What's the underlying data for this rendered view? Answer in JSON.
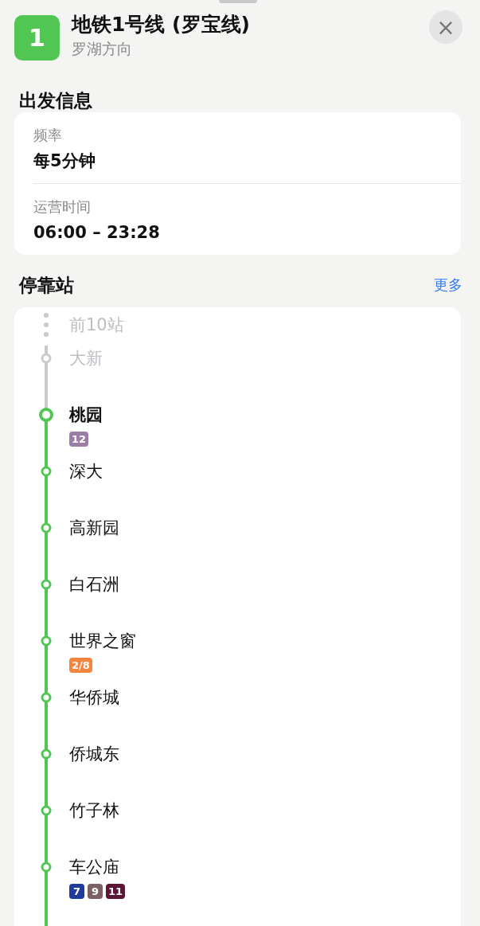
{
  "header": {
    "line_number": "1",
    "title": "地铁1号线 (罗宝线)",
    "subtitle": "罗湖方向",
    "close": "×"
  },
  "departure": {
    "title": "出发信息",
    "rows": [
      {
        "label": "频率",
        "value": "每5分钟"
      },
      {
        "label": "运营时间",
        "value": "06:00 – 23:28"
      }
    ]
  },
  "stops": {
    "title": "停靠站",
    "more": "更多",
    "stations": [
      {
        "kind": "collapsed",
        "name": "前10站"
      },
      {
        "kind": "passed",
        "name": "大新"
      },
      {
        "kind": "current",
        "name": "桃园",
        "transfers": [
          {
            "label": "12",
            "color": "#9a7ea5"
          }
        ]
      },
      {
        "kind": "stop",
        "name": "深大"
      },
      {
        "kind": "stop",
        "name": "高新园"
      },
      {
        "kind": "stop",
        "name": "白石洲"
      },
      {
        "kind": "stop",
        "name": "世界之窗",
        "transfers": [
          {
            "label": "2/8",
            "color": "#f7843e"
          }
        ]
      },
      {
        "kind": "stop",
        "name": "华侨城"
      },
      {
        "kind": "stop",
        "name": "侨城东"
      },
      {
        "kind": "stop",
        "name": "竹子林"
      },
      {
        "kind": "stop",
        "name": "车公庙",
        "transfers": [
          {
            "label": "7",
            "color": "#1f3a9c"
          },
          {
            "label": "9",
            "color": "#7b6066"
          },
          {
            "label": "11",
            "color": "#5b1735"
          }
        ]
      }
    ]
  }
}
